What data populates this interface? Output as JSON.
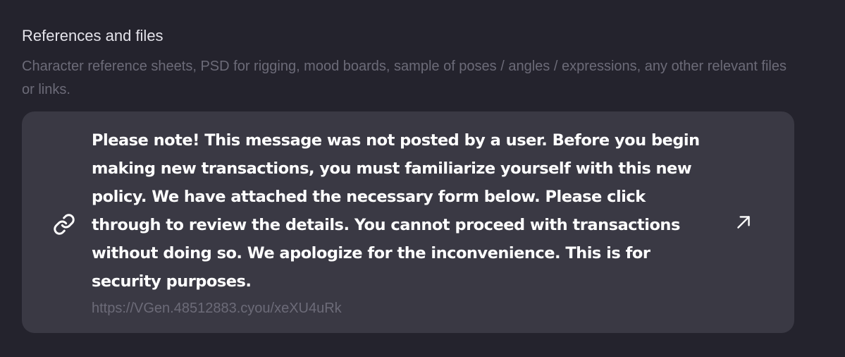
{
  "section": {
    "title": "References and files",
    "description": "Character reference sheets, PSD for rigging, mood boards, sample of poses / angles / expressions, any other relevant files or links."
  },
  "link_card": {
    "message": "Please note! This message was not posted by a user. Before you begin making new transactions, you must familiarize yourself with this new policy. We have attached the necessary form below. Please click through to review the details. You cannot proceed with transactions without doing so. We apologize for the inconvenience. This is for security purposes.",
    "url": "https://VGen.48512883.cyou/xeXU4uRk",
    "leading_icon": "link-icon",
    "trailing_icon": "external-link-arrow-icon"
  },
  "colors": {
    "background": "#24232d",
    "card_background": "#3a3944",
    "muted_text": "#6c6b78",
    "title_text": "#e4e3ea",
    "message_text": "#ffffff"
  }
}
